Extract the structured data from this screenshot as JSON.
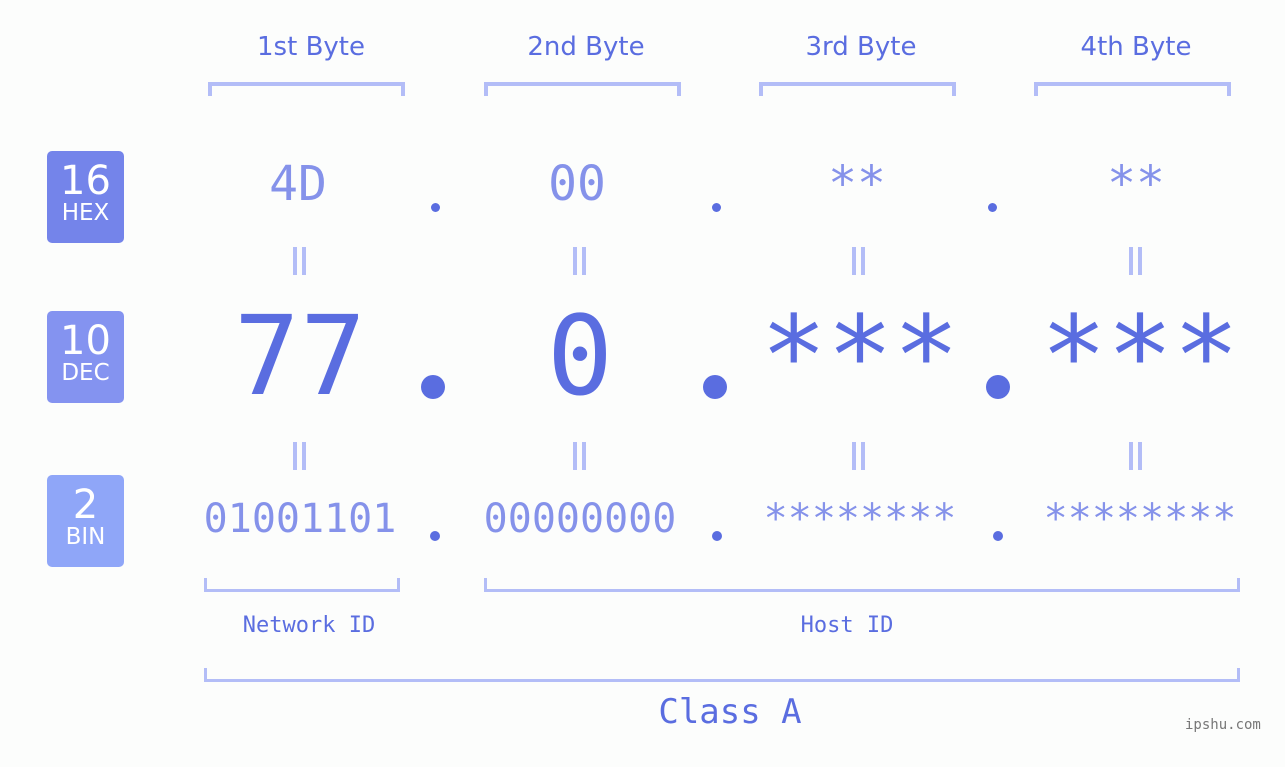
{
  "bytes": [
    {
      "label": "1st Byte",
      "hex": "4D",
      "dec": "77",
      "bin": "01001101"
    },
    {
      "label": "2nd Byte",
      "hex": "00",
      "dec": "0",
      "bin": "00000000"
    },
    {
      "label": "3rd Byte",
      "hex": "**",
      "dec": "***",
      "bin": "********"
    },
    {
      "label": "4th Byte",
      "hex": "**",
      "dec": "***",
      "bin": "********"
    }
  ],
  "badges": {
    "hex": {
      "number": "16",
      "label": "HEX",
      "color": "#7484ea"
    },
    "dec": {
      "number": "10",
      "label": "DEC",
      "color": "#8493f0"
    },
    "bin": {
      "number": "2",
      "label": "BIN",
      "color": "#8fa6f8"
    }
  },
  "labels": {
    "network_id": "Network ID",
    "host_id": "Host ID",
    "class": "Class A"
  },
  "watermark": "ipshu.com",
  "colors": {
    "accent": "#5a6de0",
    "light_accent": "#8592ea",
    "bracket": "#b3bdf7",
    "background": "#fcfdfc"
  }
}
